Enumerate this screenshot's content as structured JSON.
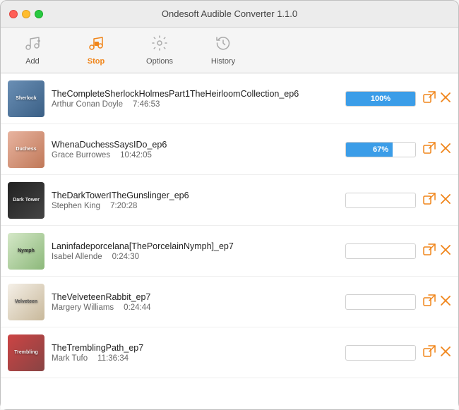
{
  "window": {
    "title": "Ondesoft Audible Converter 1.1.0"
  },
  "toolbar": {
    "buttons": [
      {
        "id": "add",
        "label": "Add",
        "icon": "♪+",
        "active": false
      },
      {
        "id": "stop",
        "label": "Stop",
        "icon": "⏹",
        "active": true
      },
      {
        "id": "options",
        "label": "Options",
        "icon": "⚙",
        "active": false
      },
      {
        "id": "history",
        "label": "History",
        "icon": "🕐",
        "active": false
      }
    ]
  },
  "books": [
    {
      "id": 1,
      "title": "TheCompleteSherlockHolmesPart1TheHeirloomCollection_ep6",
      "author": "Arthur Conan Doyle",
      "duration": "7:46:53",
      "progress": 100,
      "cover_label": "Sherlock"
    },
    {
      "id": 2,
      "title": "WhenaDuchessSaysIDo_ep6",
      "author": "Grace Burrowes",
      "duration": "10:42:05",
      "progress": 67,
      "cover_label": "Duchess"
    },
    {
      "id": 3,
      "title": "TheDarkTowerITheGunslinger_ep6",
      "author": "Stephen King",
      "duration": "7:20:28",
      "progress": 0,
      "cover_label": "Dark Tower"
    },
    {
      "id": 4,
      "title": "Laninfadeporcelana[ThePorcelainNymph]_ep7",
      "author": "Isabel Allende",
      "duration": "0:24:30",
      "progress": 0,
      "cover_label": "Nymph"
    },
    {
      "id": 5,
      "title": "TheVelveteenRabbit_ep7",
      "author": "Margery Williams",
      "duration": "0:24:44",
      "progress": 0,
      "cover_label": "Velveteen"
    },
    {
      "id": 6,
      "title": "TheTremblingPath_ep7",
      "author": "Mark Tufo",
      "duration": "11:36:34",
      "progress": 0,
      "cover_label": "Trembling"
    }
  ],
  "icons": {
    "export": "⧉",
    "remove": "✕",
    "add_icon": "♪",
    "stop_icon": "◼",
    "options_icon": "⚙",
    "history_icon": "↺"
  }
}
